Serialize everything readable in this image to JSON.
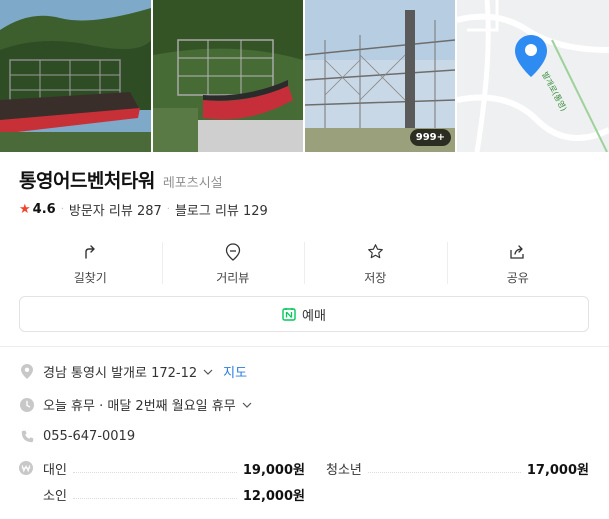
{
  "photos": {
    "count_badge": "999+",
    "map_road_label": "발개로(통영)"
  },
  "place": {
    "name": "통영어드벤처타워",
    "category": "레포츠시설",
    "rating": "4.6",
    "visitor_reviews": "방문자 리뷰 287",
    "blog_reviews": "블로그 리뷰 129"
  },
  "actions": [
    {
      "label": "길찾기",
      "icon": "directions-icon"
    },
    {
      "label": "거리뷰",
      "icon": "street-view-icon"
    },
    {
      "label": "저장",
      "icon": "star-icon"
    },
    {
      "label": "공유",
      "icon": "share-icon"
    }
  ],
  "reserve": {
    "label": "예매",
    "icon": "naver-calendar-icon"
  },
  "info": {
    "address": "경남 통영시 발개로 172-12",
    "map_link": "지도",
    "hours": "오늘 휴무 · 매달 2번째 월요일 휴무",
    "phone": "055-647-0019"
  },
  "prices": [
    {
      "name": "대인",
      "value": "19,000원"
    },
    {
      "name": "청소년",
      "value": "17,000원"
    },
    {
      "name": "소인",
      "value": "12,000원"
    }
  ],
  "colors": {
    "accent_blue": "#2a7ce4",
    "star_red": "#f0452d",
    "naver_green": "#03c75a"
  }
}
